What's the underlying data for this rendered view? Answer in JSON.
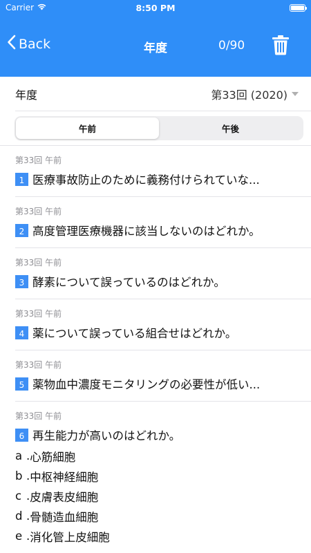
{
  "statusbar": {
    "carrier": "Carrier",
    "time": "8:50 PM"
  },
  "nav": {
    "back_label": "Back",
    "title": "年度",
    "count": "0/90",
    "back_icon": "chevron-left-icon",
    "trash_icon": "trash-icon"
  },
  "year": {
    "label": "年度",
    "selected": "第33回 (2020)"
  },
  "segment": {
    "am": "午前",
    "pm": "午後",
    "active": "am"
  },
  "questions": [
    {
      "meta": "第33回 午前",
      "num": "1",
      "text": "医療事故防止のために義務付けられていな..."
    },
    {
      "meta": "第33回 午前",
      "num": "2",
      "text": "高度管理医療機器に該当しないのはどれか。"
    },
    {
      "meta": "第33回 午前",
      "num": "3",
      "text": "酵素について誤っているのはどれか。"
    },
    {
      "meta": "第33回 午前",
      "num": "4",
      "text": "薬について誤っている組合せはどれか。"
    },
    {
      "meta": "第33回 午前",
      "num": "5",
      "text": "薬物血中濃度モニタリングの必要性が低い..."
    },
    {
      "meta": "第33回 午前",
      "num": "6",
      "text": "再生能力が高いのはどれか。",
      "options": [
        {
          "key": "a",
          "text": "心筋細胞"
        },
        {
          "key": "b",
          "text": "中枢神経細胞"
        },
        {
          "key": "c",
          "text": "皮膚表皮細胞"
        },
        {
          "key": "d",
          "text": "骨髄造血細胞"
        },
        {
          "key": "e",
          "text": "消化管上皮細胞"
        }
      ]
    }
  ],
  "colors": {
    "accent": "#2f8ef8",
    "number_badge": "#3e8ff5"
  }
}
